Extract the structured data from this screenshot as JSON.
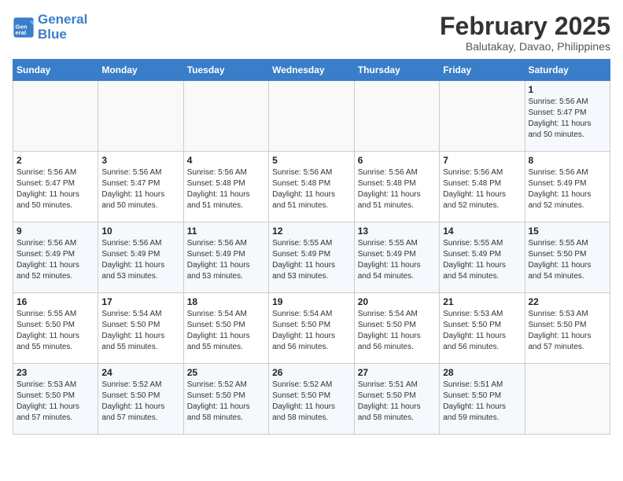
{
  "header": {
    "logo_line1": "General",
    "logo_line2": "Blue",
    "month_title": "February 2025",
    "subtitle": "Balutakay, Davao, Philippines"
  },
  "weekdays": [
    "Sunday",
    "Monday",
    "Tuesday",
    "Wednesday",
    "Thursday",
    "Friday",
    "Saturday"
  ],
  "weeks": [
    [
      {
        "day": "",
        "info": ""
      },
      {
        "day": "",
        "info": ""
      },
      {
        "day": "",
        "info": ""
      },
      {
        "day": "",
        "info": ""
      },
      {
        "day": "",
        "info": ""
      },
      {
        "day": "",
        "info": ""
      },
      {
        "day": "1",
        "info": "Sunrise: 5:56 AM\nSunset: 5:47 PM\nDaylight: 11 hours\nand 50 minutes."
      }
    ],
    [
      {
        "day": "2",
        "info": "Sunrise: 5:56 AM\nSunset: 5:47 PM\nDaylight: 11 hours\nand 50 minutes."
      },
      {
        "day": "3",
        "info": "Sunrise: 5:56 AM\nSunset: 5:47 PM\nDaylight: 11 hours\nand 50 minutes."
      },
      {
        "day": "4",
        "info": "Sunrise: 5:56 AM\nSunset: 5:48 PM\nDaylight: 11 hours\nand 51 minutes."
      },
      {
        "day": "5",
        "info": "Sunrise: 5:56 AM\nSunset: 5:48 PM\nDaylight: 11 hours\nand 51 minutes."
      },
      {
        "day": "6",
        "info": "Sunrise: 5:56 AM\nSunset: 5:48 PM\nDaylight: 11 hours\nand 51 minutes."
      },
      {
        "day": "7",
        "info": "Sunrise: 5:56 AM\nSunset: 5:48 PM\nDaylight: 11 hours\nand 52 minutes."
      },
      {
        "day": "8",
        "info": "Sunrise: 5:56 AM\nSunset: 5:49 PM\nDaylight: 11 hours\nand 52 minutes."
      }
    ],
    [
      {
        "day": "9",
        "info": "Sunrise: 5:56 AM\nSunset: 5:49 PM\nDaylight: 11 hours\nand 52 minutes."
      },
      {
        "day": "10",
        "info": "Sunrise: 5:56 AM\nSunset: 5:49 PM\nDaylight: 11 hours\nand 53 minutes."
      },
      {
        "day": "11",
        "info": "Sunrise: 5:56 AM\nSunset: 5:49 PM\nDaylight: 11 hours\nand 53 minutes."
      },
      {
        "day": "12",
        "info": "Sunrise: 5:55 AM\nSunset: 5:49 PM\nDaylight: 11 hours\nand 53 minutes."
      },
      {
        "day": "13",
        "info": "Sunrise: 5:55 AM\nSunset: 5:49 PM\nDaylight: 11 hours\nand 54 minutes."
      },
      {
        "day": "14",
        "info": "Sunrise: 5:55 AM\nSunset: 5:49 PM\nDaylight: 11 hours\nand 54 minutes."
      },
      {
        "day": "15",
        "info": "Sunrise: 5:55 AM\nSunset: 5:50 PM\nDaylight: 11 hours\nand 54 minutes."
      }
    ],
    [
      {
        "day": "16",
        "info": "Sunrise: 5:55 AM\nSunset: 5:50 PM\nDaylight: 11 hours\nand 55 minutes."
      },
      {
        "day": "17",
        "info": "Sunrise: 5:54 AM\nSunset: 5:50 PM\nDaylight: 11 hours\nand 55 minutes."
      },
      {
        "day": "18",
        "info": "Sunrise: 5:54 AM\nSunset: 5:50 PM\nDaylight: 11 hours\nand 55 minutes."
      },
      {
        "day": "19",
        "info": "Sunrise: 5:54 AM\nSunset: 5:50 PM\nDaylight: 11 hours\nand 56 minutes."
      },
      {
        "day": "20",
        "info": "Sunrise: 5:54 AM\nSunset: 5:50 PM\nDaylight: 11 hours\nand 56 minutes."
      },
      {
        "day": "21",
        "info": "Sunrise: 5:53 AM\nSunset: 5:50 PM\nDaylight: 11 hours\nand 56 minutes."
      },
      {
        "day": "22",
        "info": "Sunrise: 5:53 AM\nSunset: 5:50 PM\nDaylight: 11 hours\nand 57 minutes."
      }
    ],
    [
      {
        "day": "23",
        "info": "Sunrise: 5:53 AM\nSunset: 5:50 PM\nDaylight: 11 hours\nand 57 minutes."
      },
      {
        "day": "24",
        "info": "Sunrise: 5:52 AM\nSunset: 5:50 PM\nDaylight: 11 hours\nand 57 minutes."
      },
      {
        "day": "25",
        "info": "Sunrise: 5:52 AM\nSunset: 5:50 PM\nDaylight: 11 hours\nand 58 minutes."
      },
      {
        "day": "26",
        "info": "Sunrise: 5:52 AM\nSunset: 5:50 PM\nDaylight: 11 hours\nand 58 minutes."
      },
      {
        "day": "27",
        "info": "Sunrise: 5:51 AM\nSunset: 5:50 PM\nDaylight: 11 hours\nand 58 minutes."
      },
      {
        "day": "28",
        "info": "Sunrise: 5:51 AM\nSunset: 5:50 PM\nDaylight: 11 hours\nand 59 minutes."
      },
      {
        "day": "",
        "info": ""
      }
    ]
  ]
}
